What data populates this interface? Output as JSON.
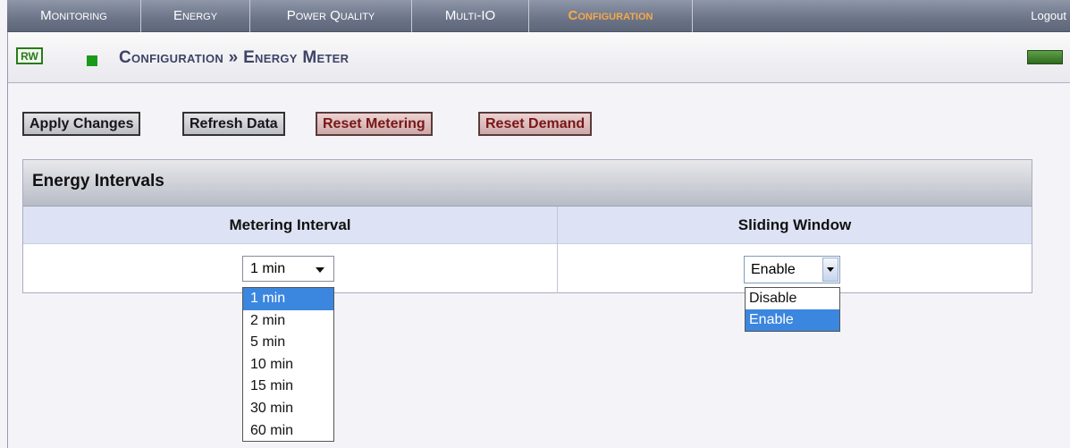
{
  "nav": {
    "tabs": [
      {
        "label": "Monitoring",
        "active": false
      },
      {
        "label": "Energy",
        "active": false
      },
      {
        "label": "Power Quality",
        "active": false
      },
      {
        "label": "Multi-IO",
        "active": false
      },
      {
        "label": "Configuration",
        "active": true
      }
    ],
    "logout_label": "Logout"
  },
  "header": {
    "rw_badge": "RW",
    "title": "Configuration » Energy Meter"
  },
  "toolbar": {
    "apply_label": "Apply Changes",
    "refresh_label": "Refresh Data",
    "reset_metering_label": "Reset Metering",
    "reset_demand_label": "Reset Demand"
  },
  "panel": {
    "title": "Energy Intervals",
    "metering_interval": {
      "header": "Metering Interval",
      "selected": "1 min",
      "options": [
        "1 min",
        "2 min",
        "5 min",
        "10 min",
        "15 min",
        "30 min",
        "60 min"
      ],
      "highlighted": "1 min"
    },
    "sliding_window": {
      "header": "Sliding Window",
      "selected": "Enable",
      "options": [
        "Disable",
        "Enable"
      ],
      "highlighted": "Enable"
    }
  },
  "colors": {
    "nav_bg": "#6c7488",
    "active_tab": "#f7a84a",
    "title_text": "#3e4366",
    "highlight": "#3b86df",
    "reset_button_text": "#7a1616"
  }
}
